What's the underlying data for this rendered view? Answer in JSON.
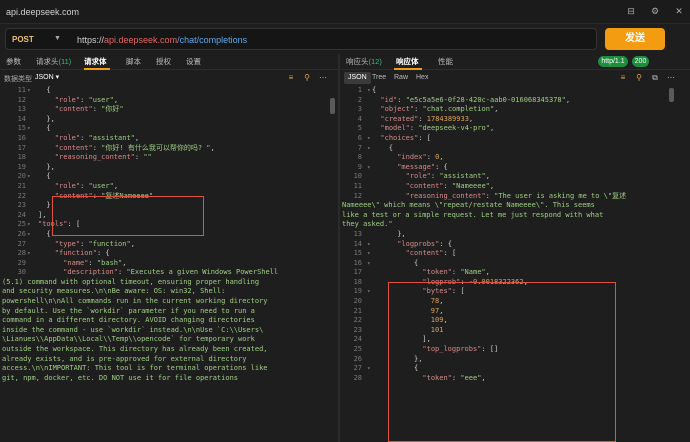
{
  "window": {
    "title": "api.deepseek.com"
  },
  "request": {
    "method": "POST",
    "url_scheme": "https://",
    "url_host": "api.deepseek.com",
    "url_path": "/chat/completions",
    "send_label": "发送"
  },
  "left_tabs": [
    {
      "label": "参数",
      "count": ""
    },
    {
      "label": "请求头",
      "count": "(11)"
    },
    {
      "label": "请求体",
      "count": ""
    },
    {
      "label": "脚本",
      "count": ""
    },
    {
      "label": "授权",
      "count": ""
    },
    {
      "label": "设置",
      "count": ""
    }
  ],
  "right_tabs": [
    {
      "label": "响应头",
      "count": "(12)"
    },
    {
      "label": "响应体",
      "count": ""
    },
    {
      "label": "性能",
      "count": ""
    }
  ],
  "badges": {
    "protocol": "http/1.1",
    "status": "200"
  },
  "left_sub": {
    "label": "数据类型",
    "format": "JSON"
  },
  "right_views": [
    "JSON",
    "Tree",
    "Raw",
    "Hex"
  ],
  "request_body": [
    {
      "ln": "11",
      "fold": "▾",
      "ind": 1,
      "parts": [
        [
          "p",
          "{"
        ]
      ]
    },
    {
      "ln": "12",
      "fold": "",
      "ind": 2,
      "parts": [
        [
          "k",
          "\"role\""
        ],
        [
          "p",
          ": "
        ],
        [
          "s",
          "\"user\""
        ],
        [
          "p",
          ","
        ]
      ]
    },
    {
      "ln": "13",
      "fold": "",
      "ind": 2,
      "parts": [
        [
          "k",
          "\"content\""
        ],
        [
          "p",
          ": "
        ],
        [
          "s",
          "\"你好\""
        ]
      ]
    },
    {
      "ln": "14",
      "fold": "",
      "ind": 1,
      "parts": [
        [
          "p",
          "},"
        ]
      ]
    },
    {
      "ln": "15",
      "fold": "▾",
      "ind": 1,
      "parts": [
        [
          "p",
          "{"
        ]
      ]
    },
    {
      "ln": "16",
      "fold": "",
      "ind": 2,
      "parts": [
        [
          "k",
          "\"role\""
        ],
        [
          "p",
          ": "
        ],
        [
          "s",
          "\"assistant\""
        ],
        [
          "p",
          ","
        ]
      ]
    },
    {
      "ln": "17",
      "fold": "",
      "ind": 2,
      "parts": [
        [
          "k",
          "\"content\""
        ],
        [
          "p",
          ": "
        ],
        [
          "s",
          "\"你好! 有什么我可以帮你的吗? \""
        ],
        [
          "p",
          ","
        ]
      ]
    },
    {
      "ln": "18",
      "fold": "",
      "ind": 2,
      "parts": [
        [
          "k",
          "\"reasoning_content\""
        ],
        [
          "p",
          ": "
        ],
        [
          "s",
          "\"\""
        ]
      ]
    },
    {
      "ln": "19",
      "fold": "",
      "ind": 1,
      "parts": [
        [
          "p",
          "},"
        ]
      ]
    },
    {
      "ln": "20",
      "fold": "▾",
      "ind": 1,
      "parts": [
        [
          "p",
          "{"
        ]
      ]
    },
    {
      "ln": "21",
      "fold": "",
      "ind": 2,
      "parts": [
        [
          "k",
          "\"role\""
        ],
        [
          "p",
          ": "
        ],
        [
          "s",
          "\"user\""
        ],
        [
          "p",
          ","
        ]
      ]
    },
    {
      "ln": "22",
      "fold": "",
      "ind": 2,
      "parts": [
        [
          "k",
          "\"content\""
        ],
        [
          "p",
          ": "
        ],
        [
          "s",
          "\"复述Nameeee\""
        ]
      ]
    },
    {
      "ln": "23",
      "fold": "",
      "ind": 1,
      "parts": [
        [
          "p",
          "}"
        ]
      ]
    },
    {
      "ln": "24",
      "fold": "",
      "ind": 0,
      "parts": [
        [
          "p",
          "],"
        ]
      ]
    },
    {
      "ln": "25",
      "fold": "▾",
      "ind": 0,
      "parts": [
        [
          "k",
          "\"tools\""
        ],
        [
          "p",
          ": ["
        ]
      ]
    },
    {
      "ln": "26",
      "fold": "▾",
      "ind": 1,
      "parts": [
        [
          "p",
          "{"
        ]
      ]
    },
    {
      "ln": "27",
      "fold": "",
      "ind": 2,
      "parts": [
        [
          "k",
          "\"type\""
        ],
        [
          "p",
          ": "
        ],
        [
          "s",
          "\"function\""
        ],
        [
          "p",
          ","
        ]
      ]
    },
    {
      "ln": "28",
      "fold": "▾",
      "ind": 2,
      "parts": [
        [
          "k",
          "\"function\""
        ],
        [
          "p",
          ": {"
        ]
      ]
    },
    {
      "ln": "29",
      "fold": "",
      "ind": 3,
      "parts": [
        [
          "k",
          "\"name\""
        ],
        [
          "p",
          ": "
        ],
        [
          "s",
          "\"bash\""
        ],
        [
          "p",
          ","
        ]
      ]
    },
    {
      "ln": "30",
      "fold": "",
      "ind": 3,
      "parts": [
        [
          "k",
          "\"description\""
        ],
        [
          "p",
          ": "
        ],
        [
          "s",
          "\"Executes a given Windows PowerShell"
        ]
      ]
    },
    {
      "ln": "",
      "fold": "",
      "ind": -1,
      "parts": [
        [
          "s",
          "(5.1) command with optional timeout, ensuring proper handling"
        ]
      ]
    },
    {
      "ln": "",
      "fold": "",
      "ind": -1,
      "parts": [
        [
          "s",
          "and security measures.\\n\\nBe aware: OS: win32, Shell:"
        ]
      ]
    },
    {
      "ln": "",
      "fold": "",
      "ind": -1,
      "parts": [
        [
          "s",
          "powershell\\n\\nAll commands run in the current working directory"
        ]
      ]
    },
    {
      "ln": "",
      "fold": "",
      "ind": -1,
      "parts": [
        [
          "s",
          "by default. Use the `workdir` parameter if you need to run a"
        ]
      ]
    },
    {
      "ln": "",
      "fold": "",
      "ind": -1,
      "parts": [
        [
          "s",
          "command in a different directory. AVOID changing directories"
        ]
      ]
    },
    {
      "ln": "",
      "fold": "",
      "ind": -1,
      "parts": [
        [
          "s",
          "inside the command - use `workdir` instead.\\n\\nUse `C:\\\\Users\\"
        ]
      ]
    },
    {
      "ln": "",
      "fold": "",
      "ind": -1,
      "parts": [
        [
          "s",
          "\\Lianues\\\\AppData\\\\Local\\\\Temp\\\\opencode` for temporary work"
        ]
      ]
    },
    {
      "ln": "",
      "fold": "",
      "ind": -1,
      "parts": [
        [
          "s",
          "outside the workspace. This directory has already been created,"
        ]
      ]
    },
    {
      "ln": "",
      "fold": "",
      "ind": -1,
      "parts": [
        [
          "s",
          "already exists, and is pre-approved for external directory"
        ]
      ]
    },
    {
      "ln": "",
      "fold": "",
      "ind": -1,
      "parts": [
        [
          "s",
          "access.\\n\\nIMPORTANT: This tool is for terminal operations like"
        ]
      ]
    },
    {
      "ln": "",
      "fold": "",
      "ind": -1,
      "parts": [
        [
          "s",
          "git, npm, docker, etc. DO NOT use it for file operations"
        ]
      ]
    }
  ],
  "response_body": [
    {
      "ln": "1",
      "fold": "▾",
      "ind": 0,
      "parts": [
        [
          "p",
          "{"
        ]
      ]
    },
    {
      "ln": "2",
      "fold": "",
      "ind": 1,
      "parts": [
        [
          "k",
          "\"id\""
        ],
        [
          "p",
          ": "
        ],
        [
          "s",
          "\"e5c5a5e6-0f28-420c-aab0-016068345378\""
        ],
        [
          "p",
          ","
        ]
      ]
    },
    {
      "ln": "3",
      "fold": "",
      "ind": 1,
      "parts": [
        [
          "k",
          "\"object\""
        ],
        [
          "p",
          ": "
        ],
        [
          "s",
          "\"chat.completion\""
        ],
        [
          "p",
          ","
        ]
      ]
    },
    {
      "ln": "4",
      "fold": "",
      "ind": 1,
      "parts": [
        [
          "k",
          "\"created\""
        ],
        [
          "p",
          ": "
        ],
        [
          "n",
          "1784389933"
        ],
        [
          "p",
          ","
        ]
      ]
    },
    {
      "ln": "5",
      "fold": "",
      "ind": 1,
      "parts": [
        [
          "k",
          "\"model\""
        ],
        [
          "p",
          ": "
        ],
        [
          "s",
          "\"deepseek-v4-pro\""
        ],
        [
          "p",
          ","
        ]
      ]
    },
    {
      "ln": "6",
      "fold": "▾",
      "ind": 1,
      "parts": [
        [
          "k",
          "\"choices\""
        ],
        [
          "p",
          ": ["
        ]
      ]
    },
    {
      "ln": "7",
      "fold": "▾",
      "ind": 2,
      "parts": [
        [
          "p",
          "{"
        ]
      ]
    },
    {
      "ln": "8",
      "fold": "",
      "ind": 3,
      "parts": [
        [
          "k",
          "\"index\""
        ],
        [
          "p",
          ": "
        ],
        [
          "n",
          "0"
        ],
        [
          "p",
          ","
        ]
      ]
    },
    {
      "ln": "9",
      "fold": "▾",
      "ind": 3,
      "parts": [
        [
          "k",
          "\"message\""
        ],
        [
          "p",
          ": {"
        ]
      ]
    },
    {
      "ln": "10",
      "fold": "",
      "ind": 4,
      "parts": [
        [
          "k",
          "\"role\""
        ],
        [
          "p",
          ": "
        ],
        [
          "s",
          "\"assistant\""
        ],
        [
          "p",
          ","
        ]
      ]
    },
    {
      "ln": "11",
      "fold": "",
      "ind": 4,
      "parts": [
        [
          "k",
          "\"content\""
        ],
        [
          "p",
          ": "
        ],
        [
          "s",
          "\"Nameeee\""
        ],
        [
          "p",
          ","
        ]
      ]
    },
    {
      "ln": "12",
      "fold": "",
      "ind": 4,
      "parts": [
        [
          "k",
          "\"reasoning_content\""
        ],
        [
          "p",
          ": "
        ],
        [
          "s",
          "\"The user is asking me to \\\"复述"
        ]
      ]
    },
    {
      "ln": "",
      "fold": "",
      "ind": -1,
      "parts": [
        [
          "s",
          "Nameeee\\\" which means \\\"repeat/restate Nameeee\\\". This seems"
        ]
      ]
    },
    {
      "ln": "",
      "fold": "",
      "ind": -1,
      "parts": [
        [
          "s",
          "like a test or a simple request. Let me just respond with what"
        ]
      ]
    },
    {
      "ln": "",
      "fold": "",
      "ind": -1,
      "parts": [
        [
          "s",
          "they asked.\""
        ]
      ]
    },
    {
      "ln": "13",
      "fold": "",
      "ind": 3,
      "parts": [
        [
          "p",
          "},"
        ]
      ]
    },
    {
      "ln": "14",
      "fold": "▾",
      "ind": 3,
      "parts": [
        [
          "k",
          "\"logprobs\""
        ],
        [
          "p",
          ": {"
        ]
      ]
    },
    {
      "ln": "15",
      "fold": "▾",
      "ind": 4,
      "parts": [
        [
          "k",
          "\"content\""
        ],
        [
          "p",
          ": ["
        ]
      ]
    },
    {
      "ln": "16",
      "fold": "▾",
      "ind": 5,
      "parts": [
        [
          "p",
          "{"
        ]
      ]
    },
    {
      "ln": "17",
      "fold": "",
      "ind": 6,
      "parts": [
        [
          "k",
          "\"token\""
        ],
        [
          "p",
          ": "
        ],
        [
          "s",
          "\"Name\""
        ],
        [
          "p",
          ","
        ]
      ]
    },
    {
      "ln": "18",
      "fold": "",
      "ind": 6,
      "parts": [
        [
          "k",
          "\"logprob\""
        ],
        [
          "p",
          ": "
        ],
        [
          "n",
          "-0.0018322362"
        ],
        [
          "p",
          ","
        ]
      ]
    },
    {
      "ln": "19",
      "fold": "▾",
      "ind": 6,
      "parts": [
        [
          "k",
          "\"bytes\""
        ],
        [
          "p",
          ": ["
        ]
      ]
    },
    {
      "ln": "20",
      "fold": "",
      "ind": 7,
      "parts": [
        [
          "n",
          "78"
        ],
        [
          "p",
          ","
        ]
      ]
    },
    {
      "ln": "21",
      "fold": "",
      "ind": 7,
      "parts": [
        [
          "n",
          "97"
        ],
        [
          "p",
          ","
        ]
      ]
    },
    {
      "ln": "22",
      "fold": "",
      "ind": 7,
      "parts": [
        [
          "n",
          "109"
        ],
        [
          "p",
          ","
        ]
      ]
    },
    {
      "ln": "23",
      "fold": "",
      "ind": 7,
      "parts": [
        [
          "n",
          "101"
        ]
      ]
    },
    {
      "ln": "24",
      "fold": "",
      "ind": 6,
      "parts": [
        [
          "p",
          "],"
        ]
      ]
    },
    {
      "ln": "25",
      "fold": "",
      "ind": 6,
      "parts": [
        [
          "k",
          "\"top_logprobs\""
        ],
        [
          "p",
          ": []"
        ]
      ]
    },
    {
      "ln": "26",
      "fold": "",
      "ind": 5,
      "parts": [
        [
          "p",
          "},"
        ]
      ]
    },
    {
      "ln": "27",
      "fold": "▾",
      "ind": 5,
      "parts": [
        [
          "p",
          "{"
        ]
      ]
    },
    {
      "ln": "28",
      "fold": "",
      "ind": 6,
      "parts": [
        [
          "k",
          "\"token\""
        ],
        [
          "p",
          ": "
        ],
        [
          "s",
          "\"eee\""
        ],
        [
          "p",
          ","
        ]
      ]
    }
  ]
}
